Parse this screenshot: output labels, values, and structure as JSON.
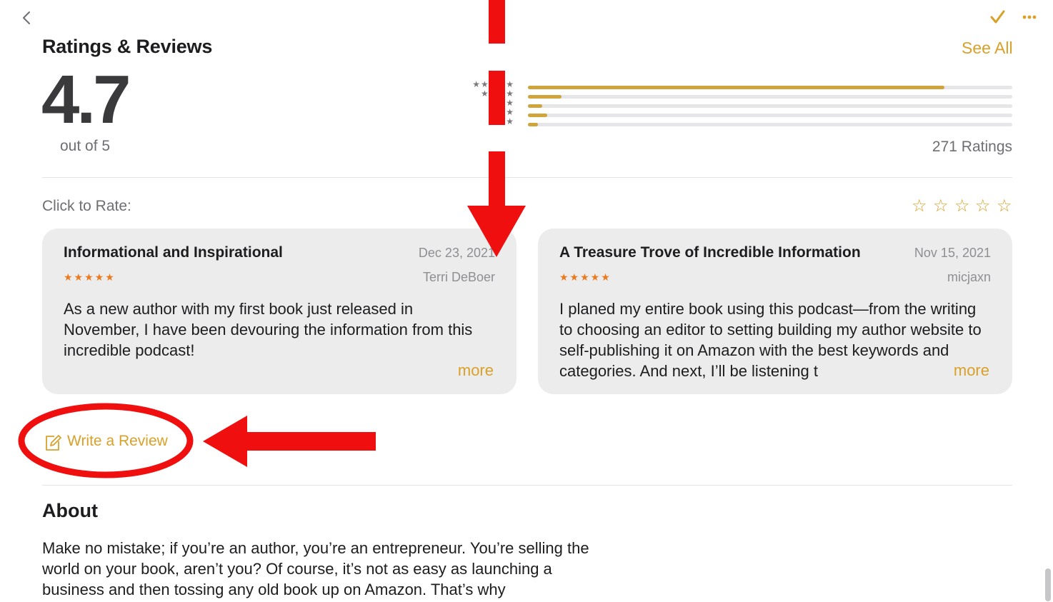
{
  "topbar": {
    "back_icon": "chevron-left-icon",
    "check_icon": "checkmark-icon",
    "more_icon": "ellipsis-icon"
  },
  "ratings": {
    "title": "Ratings & Reviews",
    "see_all": "See All",
    "average": "4.7",
    "out_of": "out of 5",
    "count_label": "271 Ratings",
    "distribution": [
      {
        "stars": 5,
        "fraction": 0.86
      },
      {
        "stars": 4,
        "fraction": 0.07
      },
      {
        "stars": 3,
        "fraction": 0.03
      },
      {
        "stars": 2,
        "fraction": 0.04
      },
      {
        "stars": 1,
        "fraction": 0.02
      }
    ]
  },
  "rate": {
    "label": "Click to Rate:",
    "star_icon": "star-outline-icon"
  },
  "reviews": [
    {
      "title": "Informational and Inspirational",
      "date": "Dec 23, 2021",
      "author": "Terri DeBoer",
      "stars": "★★★★★",
      "body": "As a new author with my first book just released in November, I have been devouring the information from this incredible podcast!",
      "more": "more"
    },
    {
      "title": "A Treasure Trove of Incredible Information",
      "date": "Nov 15, 2021",
      "author": "micjaxn",
      "stars": "★★★★★",
      "body": "I planed my entire book using this podcast—from the writing to choosing an editor to setting building my author website to self-publishing it on Amazon with the best keywords and categories. And next, I’ll be listening t",
      "more": "more"
    }
  ],
  "write_review": {
    "label": "Write a Review",
    "icon": "compose-icon"
  },
  "about": {
    "title": "About",
    "body": "Make no mistake; if you’re an author, you’re an entrepreneur. You’re selling the world on your book, aren’t you? Of course, it’s not as easy as launching a business and then tossing any old book up on Amazon. That’s why"
  },
  "colors": {
    "accent": "#d9a12a",
    "bar_fill": "#cfa43a",
    "review_stars": "#ec7a1c",
    "annotation_red": "#f00f0f",
    "card_bg": "#ececed"
  }
}
